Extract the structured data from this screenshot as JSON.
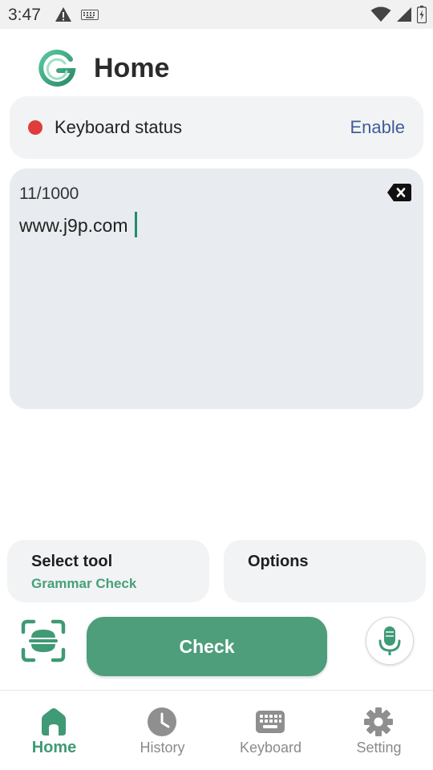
{
  "status_bar": {
    "time": "3:47",
    "icons": [
      "warning-icon",
      "keyboard-icon",
      "wifi-icon",
      "signal-icon",
      "battery-icon"
    ]
  },
  "header": {
    "title": "Home",
    "logo": "app-logo-g"
  },
  "keyboard_status": {
    "label": "Keyboard status",
    "action": "Enable",
    "indicator_color": "#e03c3c"
  },
  "editor": {
    "counter": "11/1000",
    "text": "www.j9p.com",
    "clear_icon": "clear-text-icon"
  },
  "tools": {
    "select_tool_title": "Select tool",
    "select_tool_value": "Grammar Check",
    "options_title": "Options"
  },
  "actions": {
    "check_label": "Check",
    "scan_icon": "scan-text-icon",
    "mic_icon": "microphone-icon"
  },
  "nav": {
    "items": [
      {
        "label": "Home",
        "icon": "home-icon",
        "active": true
      },
      {
        "label": "History",
        "icon": "clock-icon",
        "active": false
      },
      {
        "label": "Keyboard",
        "icon": "keyboard-icon",
        "active": false
      },
      {
        "label": "Setting",
        "icon": "gear-icon",
        "active": false
      }
    ]
  },
  "colors": {
    "brand_green": "#4e9e7c",
    "link_blue": "#3f5d99",
    "status_red": "#e03c3c"
  }
}
